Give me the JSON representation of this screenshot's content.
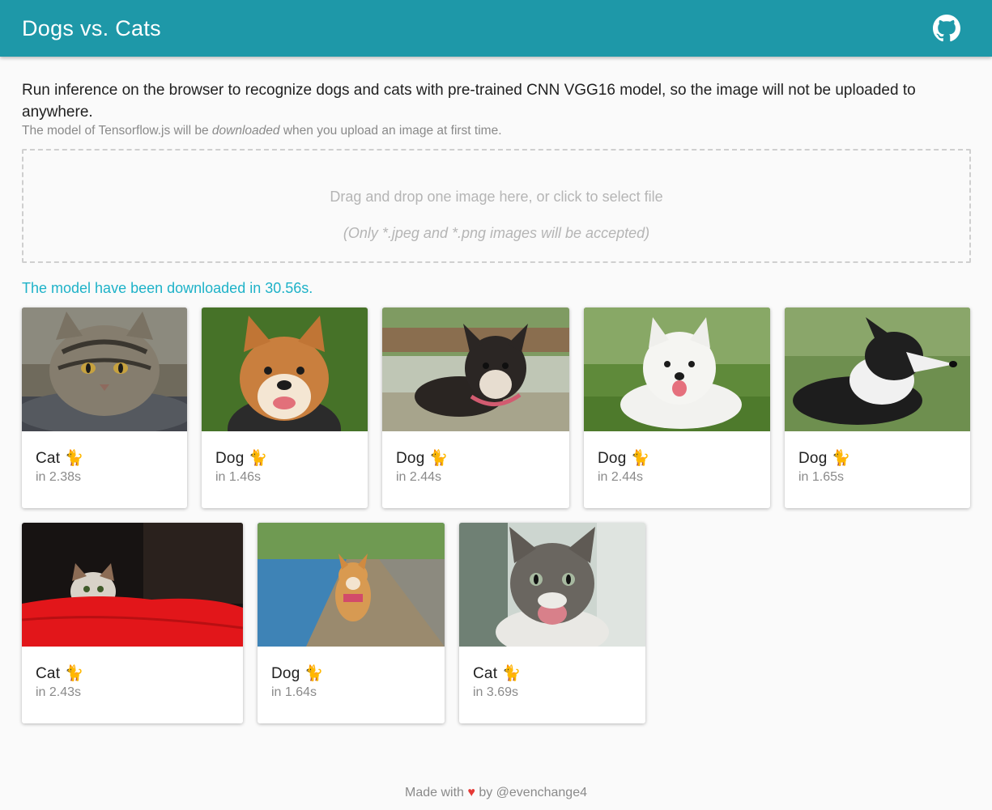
{
  "header": {
    "title": "Dogs vs. Cats",
    "github_icon": "github-icon"
  },
  "intro": {
    "text": "Run inference on the browser to recognize dogs and cats with pre-trained CNN VGG16 model, so the image will not be uploaded to anywhere.",
    "note_before": "The model of Tensorflow.js will be ",
    "note_em": "downloaded",
    "note_after": " when you upload an image at first time."
  },
  "dropzone": {
    "main": "Drag and drop one image here, or click to select file",
    "sub": "(Only *.jpeg and *.png images will be accepted)"
  },
  "status": "The model have been downloaded in 30.56s.",
  "results": [
    {
      "label": "Cat 🐈",
      "time": "in 2.38s"
    },
    {
      "label": "Dog 🐈",
      "time": "in 1.46s"
    },
    {
      "label": "Dog 🐈",
      "time": "in 2.44s"
    },
    {
      "label": "Dog 🐈",
      "time": "in 2.44s"
    },
    {
      "label": "Dog 🐈",
      "time": "in 1.65s"
    },
    {
      "label": "Cat 🐈",
      "time": "in 2.43s"
    },
    {
      "label": "Dog 🐈",
      "time": "in 1.64s"
    },
    {
      "label": "Cat 🐈",
      "time": "in 3.69s"
    }
  ],
  "footer": {
    "before": "Made with ",
    "heart": "♥",
    "after": " by @evenchange4"
  },
  "colors": {
    "appbar": "#1e98a8",
    "status": "#1eb2c8",
    "heart": "#e53935"
  }
}
